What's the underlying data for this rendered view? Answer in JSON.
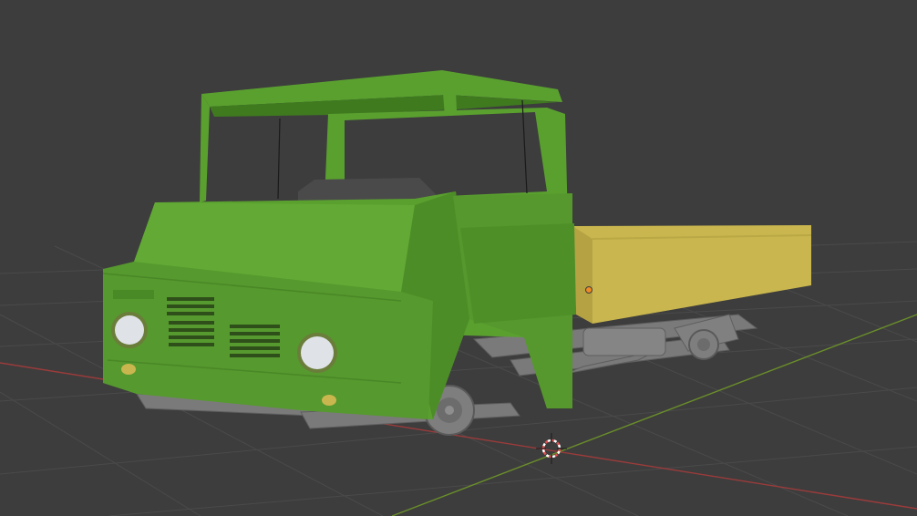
{
  "viewport": {
    "background_color": "#3d3d3d",
    "grid_color": "#4a4a4a",
    "x_axis_color": "#9b3b3b",
    "y_axis_color": "#6a8e2a"
  },
  "scene": {
    "objects": [
      {
        "name": "cab",
        "color": "#5aa02f"
      },
      {
        "name": "cargo-bed",
        "color": "#c9b64e"
      },
      {
        "name": "chassis",
        "color": "#7a7a7a"
      },
      {
        "name": "seat",
        "color": "#4a4a4a"
      }
    ],
    "cursor_icon": "3d-cursor-icon",
    "origin_icon": "object-origin-icon"
  }
}
